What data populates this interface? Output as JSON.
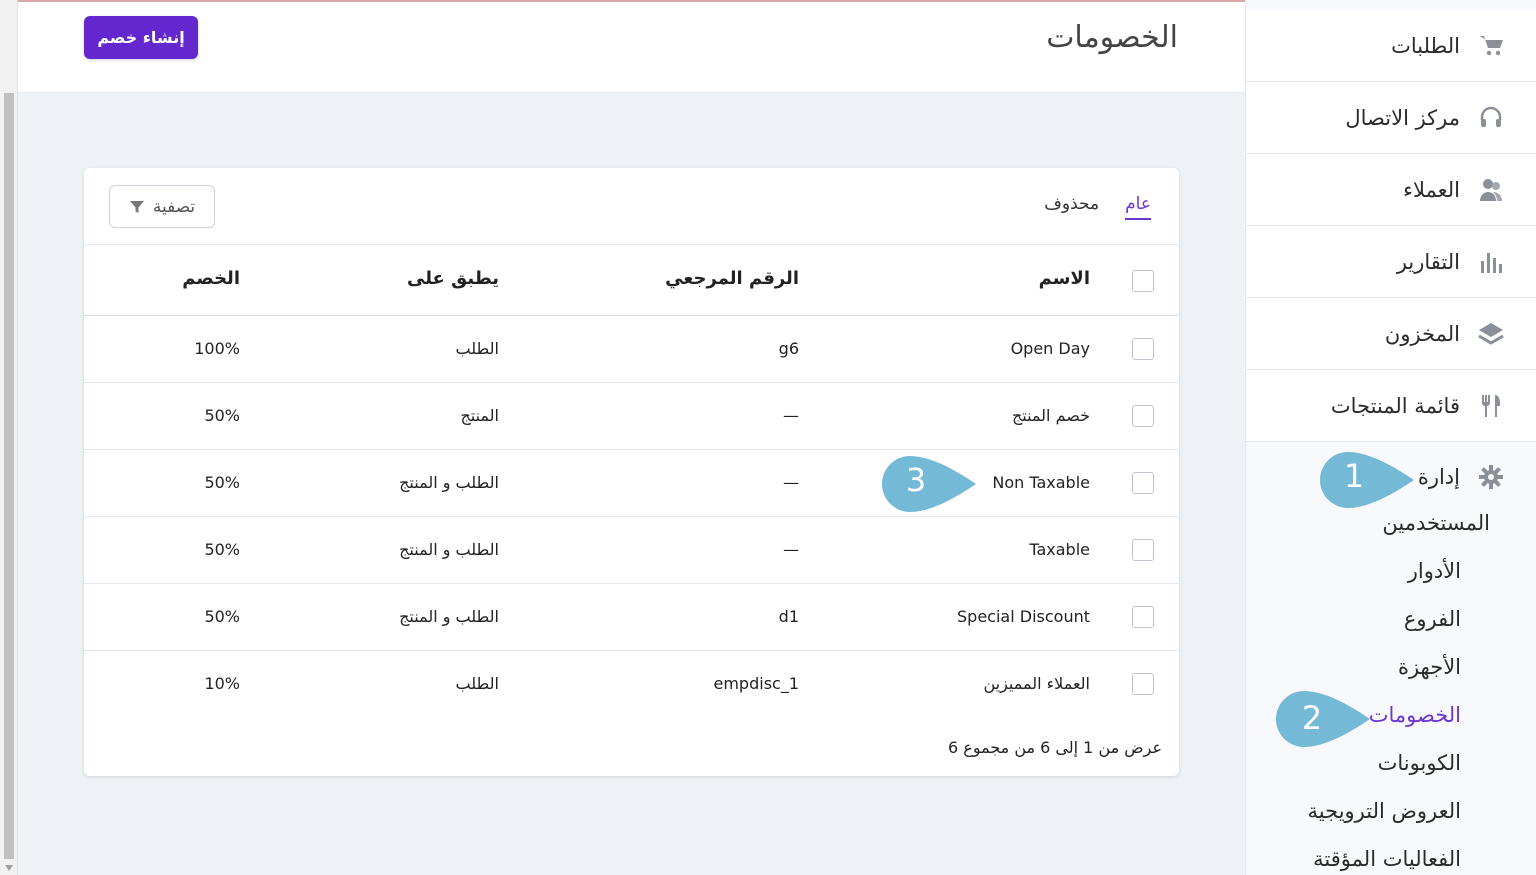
{
  "header": {
    "title": "الخصومات",
    "create_button": "إنشاء خصم"
  },
  "sidebar": {
    "items": [
      {
        "label": "الطلبات",
        "icon": "cart-icon"
      },
      {
        "label": "مركز الاتصال",
        "icon": "headset-icon"
      },
      {
        "label": "العملاء",
        "icon": "users-icon"
      },
      {
        "label": "التقارير",
        "icon": "bar-chart-icon"
      },
      {
        "label": "المخزون",
        "icon": "layers-icon"
      },
      {
        "label": "قائمة المنتجات",
        "icon": "utensils-icon"
      }
    ],
    "admin": {
      "label": "إدارة",
      "icon": "gear-icon",
      "sub_items": [
        {
          "label": "المستخدمين"
        },
        {
          "label": "الأدوار"
        },
        {
          "label": "الفروع"
        },
        {
          "label": "الأجهزة"
        },
        {
          "label": "الخصومات"
        },
        {
          "label": "الكوبونات"
        },
        {
          "label": "العروض الترويجية"
        },
        {
          "label": "الفعاليات المؤقتة"
        }
      ]
    }
  },
  "tabs": [
    {
      "label": "عام"
    },
    {
      "label": "محذوف"
    }
  ],
  "filter_button": "تصفية",
  "table": {
    "headers": {
      "name": "الاسم",
      "reference": "الرقم المرجعي",
      "applies_to": "يطبق على",
      "discount": "الخصم"
    },
    "rows": [
      {
        "name": "Open Day",
        "reference": "g6",
        "applies_to": "الطلب",
        "discount": "100%"
      },
      {
        "name": "خصم المنتج",
        "reference": "—",
        "applies_to": "المنتج",
        "discount": "50%"
      },
      {
        "name": "Non Taxable",
        "reference": "—",
        "applies_to": "الطلب و المنتج",
        "discount": "50%"
      },
      {
        "name": "Taxable",
        "reference": "—",
        "applies_to": "الطلب و المنتج",
        "discount": "50%"
      },
      {
        "name": "Special Discount",
        "reference": "d1",
        "applies_to": "الطلب و المنتج",
        "discount": "50%"
      },
      {
        "name": "العملاء المميزين",
        "reference": "empdisc_1",
        "applies_to": "الطلب",
        "discount": "10%"
      }
    ]
  },
  "footer": "عرض من 1 إلى 6 من مجموع 6",
  "callouts": [
    "1",
    "2",
    "3"
  ],
  "colors": {
    "accent": "#6426cf",
    "callout": "#74b9d6"
  }
}
